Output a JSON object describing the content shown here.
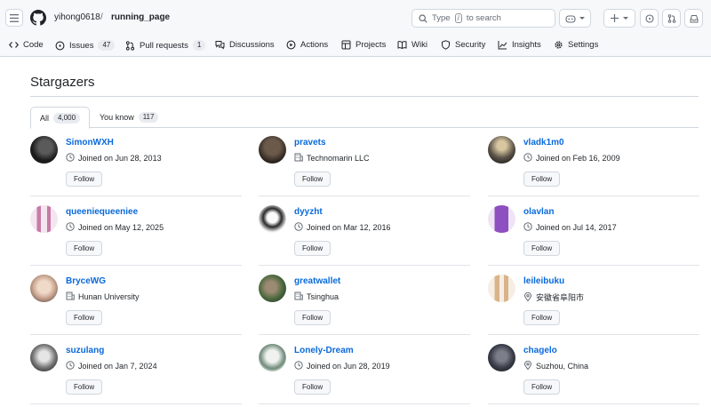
{
  "header": {
    "owner": "yihong0618",
    "separator": "/",
    "repo": "running_page",
    "search_placeholder_prefix": "Type",
    "search_key": "/",
    "search_placeholder_suffix": "to search"
  },
  "nav": {
    "tabs": [
      {
        "label": "Code",
        "icon": "code-icon"
      },
      {
        "label": "Issues",
        "count": "47",
        "icon": "issue-icon"
      },
      {
        "label": "Pull requests",
        "count": "1",
        "icon": "pull-request-icon"
      },
      {
        "label": "Discussions",
        "icon": "discussion-icon"
      },
      {
        "label": "Actions",
        "icon": "play-icon"
      },
      {
        "label": "Projects",
        "icon": "table-icon"
      },
      {
        "label": "Wiki",
        "icon": "book-icon"
      },
      {
        "label": "Security",
        "icon": "shield-icon"
      },
      {
        "label": "Insights",
        "icon": "graph-icon"
      },
      {
        "label": "Settings",
        "icon": "gear-icon"
      }
    ]
  },
  "page": {
    "title": "Stargazers",
    "subtabs": [
      {
        "label": "All",
        "count": "4,000"
      },
      {
        "label": "You know",
        "count": "117"
      }
    ],
    "follow_label": "Follow"
  },
  "users": [
    {
      "name": "SimonWXH",
      "meta_type": "clock",
      "meta": "Joined on Jun 28, 2013"
    },
    {
      "name": "pravets",
      "meta_type": "org",
      "meta": "Technomarin LLC"
    },
    {
      "name": "vladk1m0",
      "meta_type": "clock",
      "meta": "Joined on Feb 16, 2009"
    },
    {
      "name": "queeniequeeniee",
      "meta_type": "clock",
      "meta": "Joined on May 12, 2025"
    },
    {
      "name": "dyyzht",
      "meta_type": "clock",
      "meta": "Joined on Mar 12, 2016"
    },
    {
      "name": "olavlan",
      "meta_type": "clock",
      "meta": "Joined on Jul 14, 2017"
    },
    {
      "name": "BryceWG",
      "meta_type": "org",
      "meta": "Hunan University"
    },
    {
      "name": "greatwallet",
      "meta_type": "org",
      "meta": "Tsinghua"
    },
    {
      "name": "leileibuku",
      "meta_type": "location",
      "meta": "安徽省阜阳市"
    },
    {
      "name": "suzulang",
      "meta_type": "clock",
      "meta": "Joined on Jan 7, 2024"
    },
    {
      "name": "Lonely-Dream",
      "meta_type": "clock",
      "meta": "Joined on Jun 28, 2019"
    },
    {
      "name": "chagelo",
      "meta_type": "location",
      "meta": "Suzhou, China"
    }
  ],
  "colors": {
    "link": "#0969da",
    "border": "#d0d7de",
    "header_bg": "#f6f8fa",
    "text": "#1f2328",
    "muted": "#656d76"
  }
}
